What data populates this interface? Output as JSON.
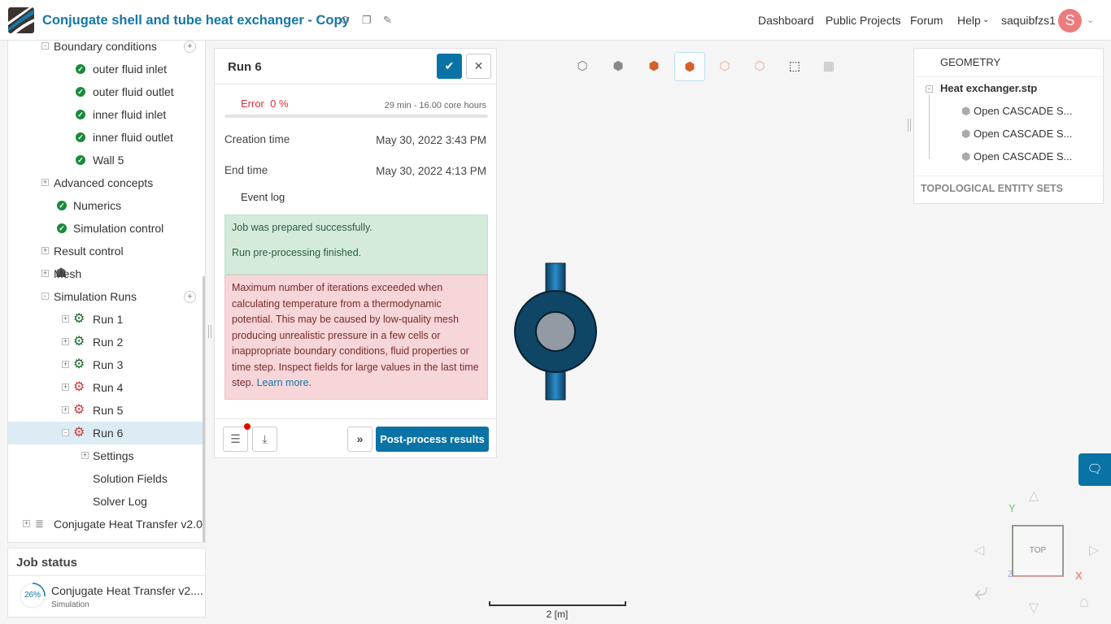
{
  "header": {
    "title": "Conjugate shell and tube heat exchanger - Copy",
    "nav": [
      "Dashboard",
      "Public Projects",
      "Forum",
      "Help"
    ],
    "username": "saquibfzs1",
    "avatar_letter": "S"
  },
  "sidebar": {
    "tree": [
      {
        "label": "Boundary conditions",
        "level": 1,
        "exp": "-",
        "add": true
      },
      {
        "label": "outer fluid inlet",
        "level": 2,
        "icon": "check"
      },
      {
        "label": "outer fluid outlet",
        "level": 2,
        "icon": "check"
      },
      {
        "label": "inner fluid inlet",
        "level": 2,
        "icon": "check"
      },
      {
        "label": "inner fluid outlet",
        "level": 2,
        "icon": "check"
      },
      {
        "label": "Wall 5",
        "level": 2,
        "icon": "check"
      },
      {
        "label": "Advanced concepts",
        "level": 1,
        "exp": "+"
      },
      {
        "label": "Numerics",
        "level": 1.5,
        "icon": "check"
      },
      {
        "label": "Simulation control",
        "level": 1.5,
        "icon": "check"
      },
      {
        "label": "Result control",
        "level": 1,
        "exp": "+"
      },
      {
        "label": "Mesh",
        "level": 1,
        "exp": "+",
        "icon": "mesh"
      },
      {
        "label": "Simulation Runs",
        "level": 1,
        "exp": "-",
        "add": true
      },
      {
        "label": "Run 1",
        "level": 2,
        "exp": "+",
        "icon": "gear-ok"
      },
      {
        "label": "Run 2",
        "level": 2,
        "exp": "+",
        "icon": "gear-ok"
      },
      {
        "label": "Run 3",
        "level": 2,
        "exp": "+",
        "icon": "gear-ok"
      },
      {
        "label": "Run 4",
        "level": 2,
        "exp": "+",
        "icon": "gear-err"
      },
      {
        "label": "Run 5",
        "level": 2,
        "exp": "+",
        "icon": "gear-err"
      },
      {
        "label": "Run 6",
        "level": 2,
        "exp": "-",
        "icon": "gear-err",
        "selected": true
      },
      {
        "label": "Settings",
        "level": 3,
        "exp": "+"
      },
      {
        "label": "Solution Fields",
        "level": 3
      },
      {
        "label": "Solver Log",
        "level": 3
      },
      {
        "label": "Conjugate Heat Transfer v2.0...",
        "level": 0,
        "exp": "+",
        "icon": "sim"
      }
    ]
  },
  "job_status": {
    "title": "Job status",
    "progress": "26%",
    "progress_value": 0.26,
    "name": "Conjugate Heat Transfer v2....",
    "type": "Simulation"
  },
  "run_panel": {
    "title": "Run 6",
    "status": "Error",
    "percent": "0 %",
    "duration": "29 min - 16.00 core hours",
    "creation_label": "Creation time",
    "creation_value": "May 30, 2022 3:43 PM",
    "end_label": "End time",
    "end_value": "May 30, 2022 4:13 PM",
    "event_log_label": "Event log",
    "success_msgs": [
      "Job was prepared successfully.",
      "Run pre-processing finished."
    ],
    "error_msg": "Maximum number of iterations exceeded when calculating temperature from a thermodynamic potential. This may be caused by low-quality mesh producing unrealistic pressure in a few cells or inappropriate boundary conditions, fluid properties or time step. Inspect fields for large values in the last time step.",
    "learn_more": "Learn more",
    "post_process": "Post-process results"
  },
  "geometry": {
    "title": "GEOMETRY",
    "file": "Heat exchanger.stp",
    "items": [
      "Open CASCADE S...",
      "Open CASCADE S...",
      "Open CASCADE S..."
    ],
    "sets_title": "TOPOLOGICAL ENTITY SETS"
  },
  "viewer": {
    "scale_label": "2 [m]",
    "cube_label": "TOP",
    "axis_x": "X",
    "axis_y": "Y",
    "axis_z": "Z"
  },
  "colors": {
    "accent": "#0a73a6",
    "error": "#e0303a",
    "success_bg": "#d4ebdc",
    "error_bg": "#f6d6d8"
  }
}
